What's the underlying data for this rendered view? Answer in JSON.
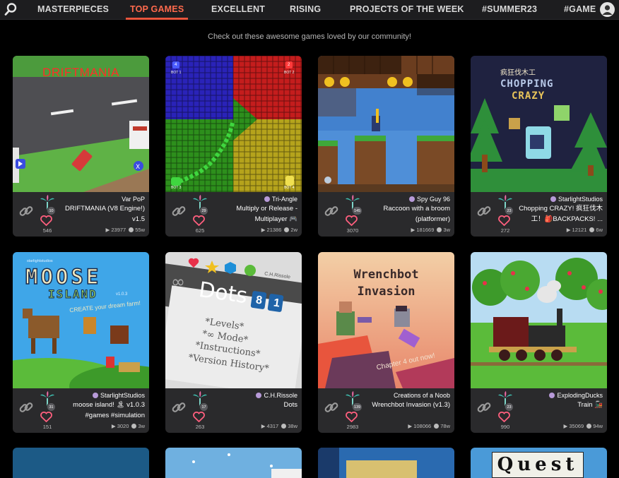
{
  "nav": {
    "tabs": [
      {
        "label": "MASTERPIECES"
      },
      {
        "label": "TOP GAMES"
      },
      {
        "label": "EXCELLENT"
      },
      {
        "label": "RISING"
      },
      {
        "label": "PROJECTS OF THE WEEK"
      },
      {
        "label": "#SUMMER23"
      },
      {
        "label": "#GAMES"
      }
    ],
    "active_tab": "TOP GAMES",
    "icons": [
      "search-icon",
      "user-avatar-icon"
    ]
  },
  "subtitle": "Check out these awesome games loved by our community!",
  "thumb_text": {
    "driftmania": "DRIFTMANIA",
    "bot1": "BOT 1",
    "bot2": "BOT 2",
    "bot3": "BOT 3",
    "bot4": "BOT 4",
    "bot_num1": "4",
    "bot_num2": "2",
    "chopping_cn": "疯狂伐木工",
    "chopping_top": "CHOPPING",
    "chopping_bottom": "CRAZY",
    "moose_studio": "starlightstudios",
    "moose_title": "MOOSE",
    "moose_island": "ISLAND",
    "moose_version": "v1.0.3",
    "moose_tagline": "CREATE your dream farm!",
    "dots_author": "C.H.Rissole",
    "dots_word": "Dots",
    "dots_num1": "8",
    "dots_num2": "1",
    "dots_menu": [
      "*Levels*",
      "*∞ Mode*",
      "*Instructions*",
      "*Version History*"
    ],
    "wrench_line1": "Wrenchbot",
    "wrench_line2": "Invasion",
    "wrench_tagline": "Chapter 4 out now!",
    "quest": "Quest"
  },
  "cards": [
    {
      "author": "Var PoP",
      "has_author_dot": false,
      "title": "DRIFTMANIA (V8 Engine!) v1.5",
      "followers": "10",
      "likes": "546",
      "views": "23977",
      "age": "55w",
      "icon": "game-logo-icon"
    },
    {
      "author": "Tri-Angle",
      "has_author_dot": true,
      "title": "Multiply or Release - Multiplayer 🎮",
      "followers": "29",
      "likes": "625",
      "views": "21386",
      "age": "2w",
      "icon": "game-logo-icon"
    },
    {
      "author": "Spy Guy 96",
      "has_author_dot": true,
      "title": "Raccoon with a broom (platformer)",
      "followers": "145",
      "likes": "3070",
      "views": "181669",
      "age": "3w",
      "icon": "game-logo-icon"
    },
    {
      "author": "StarlightStudios",
      "has_author_dot": true,
      "title": "Chopping CRAZY! 疯狂伐木工！🎒BACKPACKS! ...",
      "followers": "23",
      "likes": "272",
      "views": "12121",
      "age": "6w",
      "icon": "game-logo-icon"
    },
    {
      "author": "StarlightStudios",
      "has_author_dot": true,
      "title": "moose island! 🏝 v1.0.3 #games #simulation",
      "followers": "31",
      "likes": "151",
      "views": "3020",
      "age": "3w",
      "icon": "game-logo-icon"
    },
    {
      "author": "C.H.Rissole",
      "has_author_dot": true,
      "title": "Dots",
      "followers": "17",
      "likes": "263",
      "views": "4317",
      "age": "38w",
      "icon": "game-logo-icon"
    },
    {
      "author": "Creations of a Noob",
      "has_author_dot": false,
      "title": "Wrenchbot Invasion (v1.3)",
      "followers": "139",
      "likes": "2983",
      "views": "108066",
      "age": "78w",
      "icon": "game-logo-icon"
    },
    {
      "author": "ExplodingDucks",
      "has_author_dot": true,
      "title": "Train 🚂",
      "followers": "23",
      "likes": "990",
      "views": "35069",
      "age": "94w",
      "icon": "game-logo-icon"
    }
  ],
  "colors": {
    "accent": "#e8553d",
    "card_bg": "#2a2a2c",
    "heart": "#ff5f7e"
  }
}
